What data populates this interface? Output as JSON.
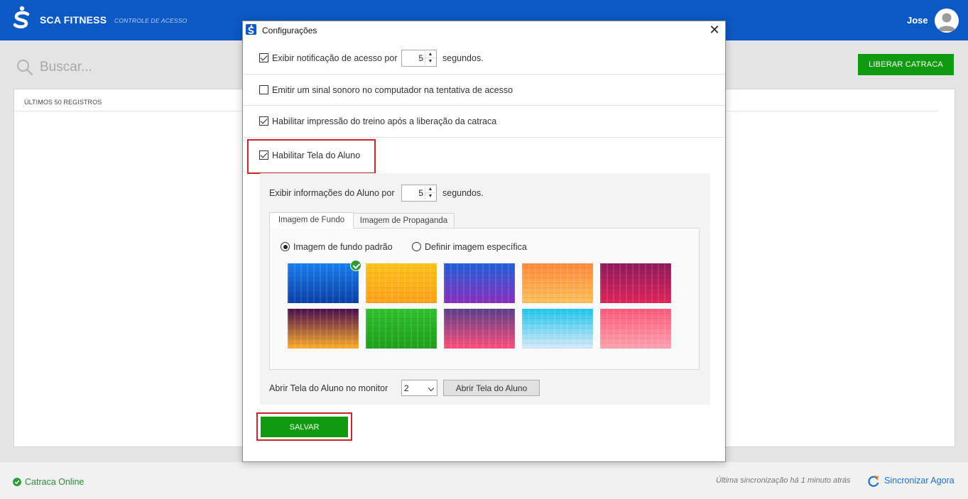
{
  "app": {
    "brand": "SCA FITNESS",
    "subtitle": "CONTROLE DE ACESSO",
    "user_name": "Jose"
  },
  "page": {
    "search_placeholder": "Buscar...",
    "liberar_label": "LIBERAR CATRACA",
    "panel_title": "ÚLTIMOS 50 REGISTROS"
  },
  "footer": {
    "status": "Catraca Online",
    "last_sync": "Última sincronização há 1 minuto atrás",
    "sync_now": "Sincronizar Agora"
  },
  "dialog": {
    "title": "Configurações",
    "close": "✕",
    "options": {
      "notif_label": "Exibir notificação de acesso por",
      "notif_seconds": "5",
      "notif_suffix": "segundos.",
      "notif_checked": true,
      "sound_label": "Emitir um sinal sonoro no computador na tentativa de acesso",
      "sound_checked": false,
      "print_label": "Habilitar impressão do treino após a liberação da catraca",
      "print_checked": true,
      "student_screen_label": "Habilitar Tela do Aluno",
      "student_screen_checked": true
    },
    "student": {
      "info_label": "Exibir informações do Aluno por",
      "info_seconds": "5",
      "info_suffix": "segundos.",
      "tabs": [
        "Imagem de Fundo",
        "Imagem de Propaganda"
      ],
      "active_tab": 0,
      "radio_default": "Imagem de fundo padrão",
      "radio_custom": "Definir imagem específica",
      "selected_background": 0,
      "backgrounds": [
        {
          "top": "#1a7ff0",
          "bottom": "#0a3fa8"
        },
        {
          "top": "#ffc21a",
          "bottom": "#ffa21a"
        },
        {
          "top": "#2060d8",
          "bottom": "#8a2fbf"
        },
        {
          "top": "#ff8a3d",
          "bottom": "#ffc05a"
        },
        {
          "top": "#8e1b5c",
          "bottom": "#e0245a"
        },
        {
          "top": "#4a0e4e",
          "bottom": "#ffae2a"
        },
        {
          "top": "#2fc12c",
          "bottom": "#1fa01c"
        },
        {
          "top": "#5a3f8a",
          "bottom": "#ff4f7a"
        },
        {
          "top": "#1ec6ec",
          "bottom": "#d8eafa"
        },
        {
          "top": "#ff5a7a",
          "bottom": "#ffa2b0"
        }
      ],
      "monitor_label": "Abrir Tela do Aluno no monitor",
      "monitor_value": "2",
      "open_button": "Abrir Tela do Aluno"
    },
    "save_label": "SALVAR"
  },
  "colors": {
    "header_blue": "#0c58c4",
    "action_green": "#0f9a0f",
    "highlight_red": "#c62828"
  }
}
